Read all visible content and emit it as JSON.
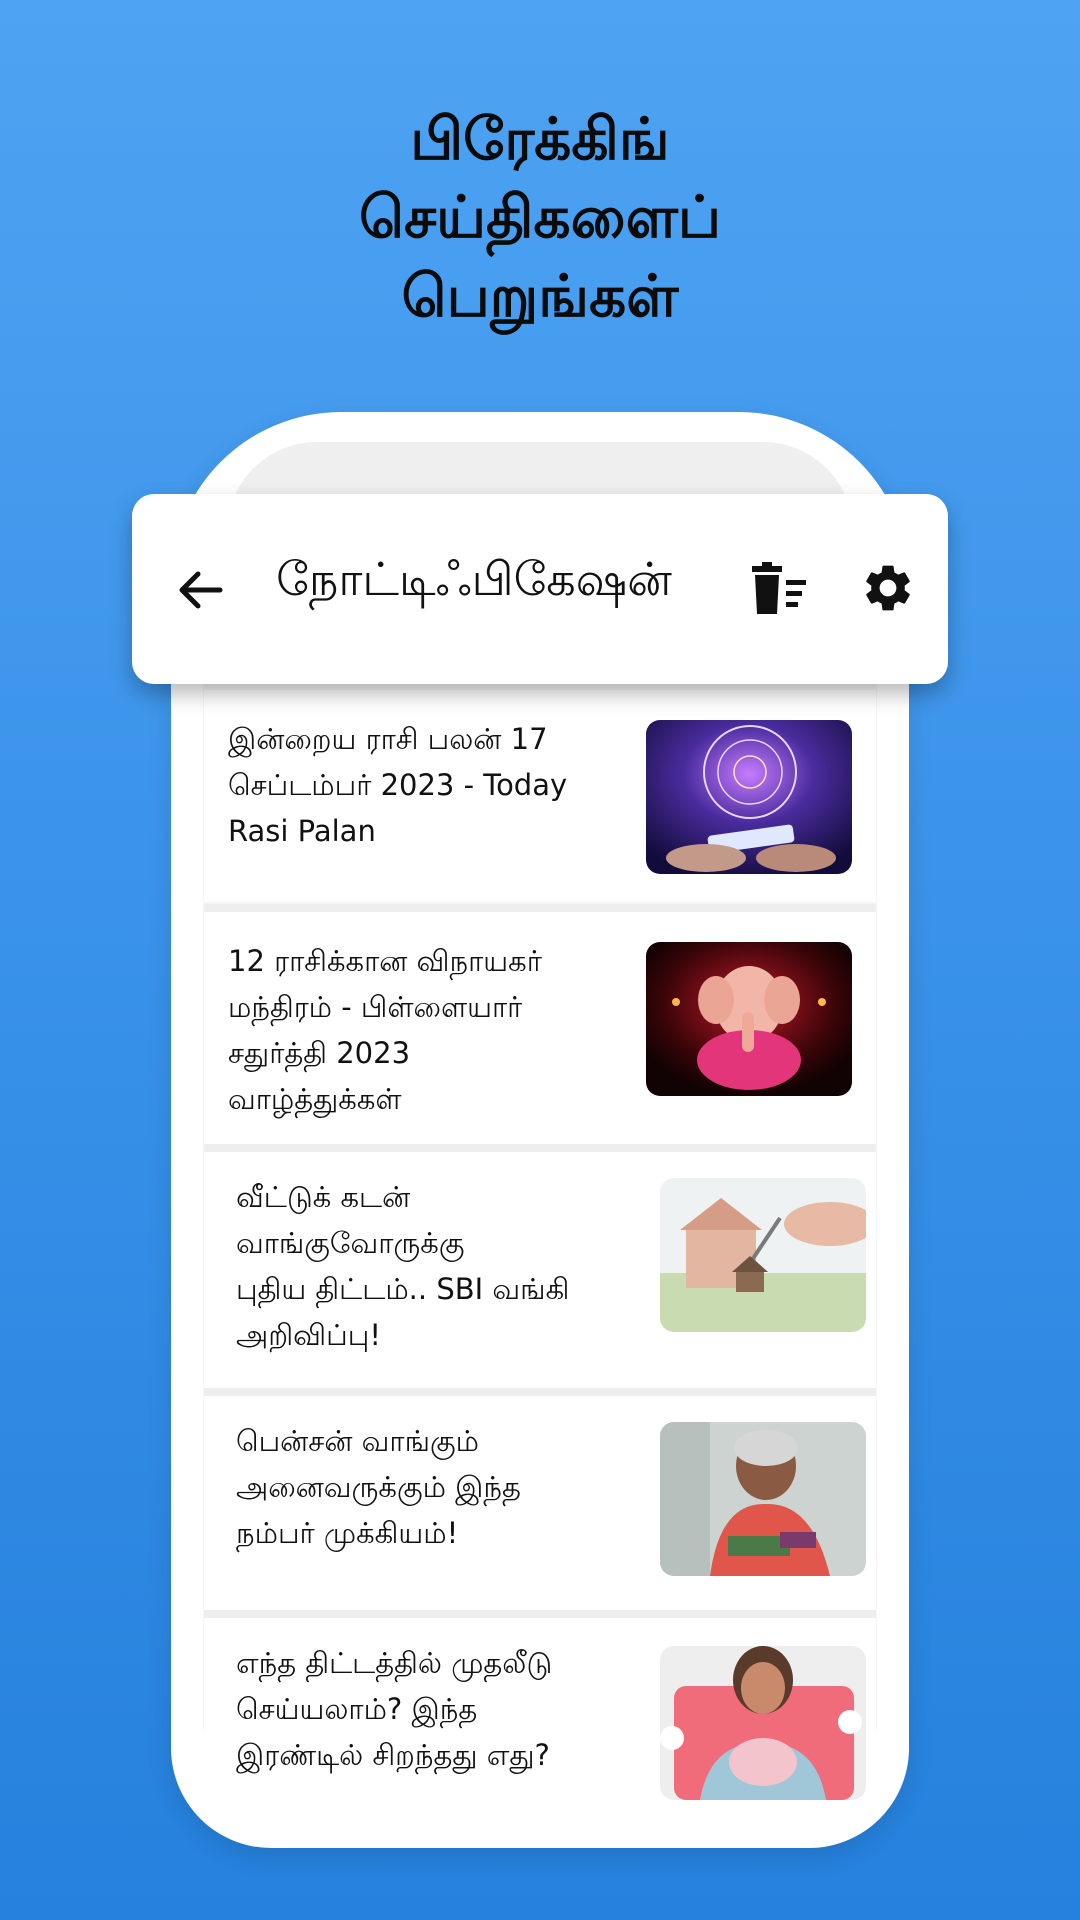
{
  "headline": {
    "line1": "பிரேக்கிங்",
    "line2": "செய்திகளைப்",
    "line3": "பெறுங்கள்"
  },
  "app_bar": {
    "title": "நோட்டிஃபிகேஷன்",
    "back_icon": "arrow-left-icon",
    "trash_icon": "delete-sweep-icon",
    "settings_icon": "gear-icon"
  },
  "news": [
    {
      "lines": [
        "இன்றைய ராசி பலன் 17",
        "செப்டம்பர் 2023 - Today",
        "Rasi Palan"
      ],
      "thumb": "zodiac-phone-image"
    },
    {
      "lines": [
        "12 ராசிக்கான விநாயகர்",
        "மந்திரம் - பிள்ளையார்",
        "சதுர்த்தி 2023",
        "வாழ்த்துக்கள்"
      ],
      "thumb": "ganesha-idol-image"
    },
    {
      "lines": [
        "வீட்டுக் கடன்",
        "வாங்குவோருக்கு",
        "புதிய திட்டம்.. SBI வங்கி",
        "அறிவிப்பு!"
      ],
      "thumb": "house-key-image"
    },
    {
      "lines": [
        "பென்சன் வாங்கும்",
        "அனைவருக்கும் இந்த",
        "நம்பர் முக்கியம்!"
      ],
      "thumb": "elderly-woman-money-image"
    },
    {
      "lines": [
        "எந்த திட்டத்தில் முதலீடு",
        "செய்யலாம்? இந்த",
        "இரண்டில் சிறந்தது எது?"
      ],
      "thumb": "woman-piggy-bank-image"
    }
  ],
  "colors": {
    "background_top": "#4ea3f2",
    "background_bottom": "#2581dd",
    "card": "#ffffff"
  }
}
